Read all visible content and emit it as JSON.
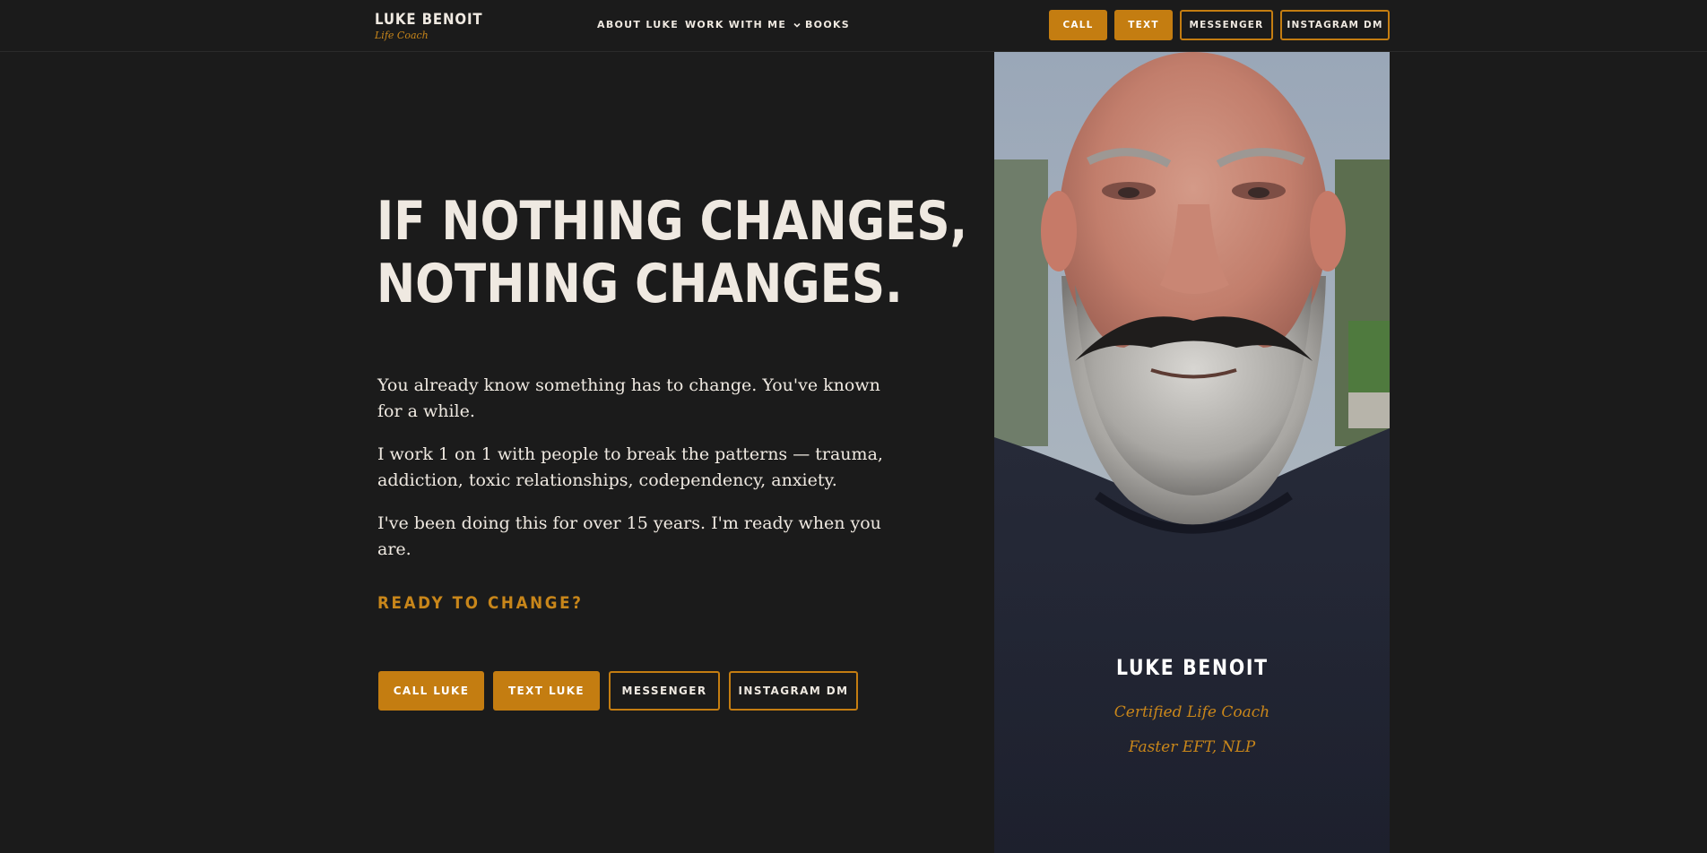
{
  "header": {
    "brand_name": "LUKE BENOIT",
    "brand_tagline": "Life Coach",
    "nav": [
      {
        "label": "ABOUT LUKE"
      },
      {
        "label": "WORK WITH ME",
        "icon": "chevron-down-icon"
      },
      {
        "label": "BOOKS"
      }
    ],
    "buttons": {
      "call": "CALL",
      "text": "TEXT",
      "messenger": "MESSENGER",
      "instagram": "INSTAGRAM DM"
    }
  },
  "hero": {
    "headline_line1": "IF NOTHING CHANGES,",
    "headline_line2": "NOTHING CHANGES.",
    "paragraphs": [
      "You already know something has to change. You've known for a while.",
      "I work 1 on 1 with people to break the patterns — trauma, addiction, toxic relationships, codependency, anxiety.",
      "I've been doing this for over 15 years. I'm ready when you are."
    ],
    "ready_label": "READY TO CHANGE?",
    "cta": {
      "call": "CALL LUKE",
      "text": "TEXT LUKE",
      "messenger": "MESSENGER",
      "instagram": "INSTAGRAM DM"
    }
  },
  "profile_card": {
    "name": "LUKE BENOIT",
    "title": "Certified Life Coach",
    "credentials": "Faster EFT, NLP"
  },
  "colors": {
    "background": "#1b1b1b",
    "accent": "#c47d11",
    "text": "#efe9e1"
  }
}
